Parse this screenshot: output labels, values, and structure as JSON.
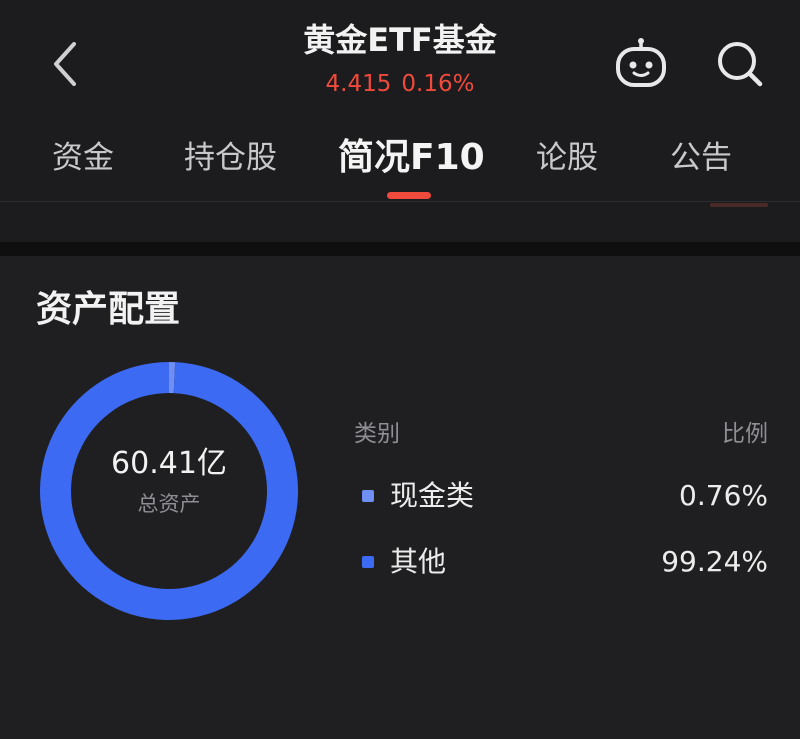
{
  "header": {
    "title": "黄金ETF基金",
    "price": "4.415",
    "change_pct": "0.16%",
    "icons": {
      "back": "chevron-left-icon",
      "assistant": "robot-icon",
      "search": "search-icon"
    }
  },
  "tabs": [
    {
      "label": "资金",
      "active": false
    },
    {
      "label": "持仓股",
      "active": false
    },
    {
      "label": "简况F10",
      "active": true
    },
    {
      "label": "论股",
      "active": false
    },
    {
      "label": "公告",
      "active": false
    }
  ],
  "asset_allocation": {
    "title": "资产配置",
    "total_value": "60.41亿",
    "total_label": "总资产",
    "legend_header": {
      "category": "类别",
      "ratio": "比例"
    },
    "items": [
      {
        "name": "现金类",
        "percent": "0.76%",
        "value": 0.76,
        "color": "#6f8ff5"
      },
      {
        "name": "其他",
        "percent": "99.24%",
        "value": 99.24,
        "color": "#3d6af2"
      }
    ]
  },
  "colors": {
    "background": "#1c1c1e",
    "card": "#1f1f21",
    "accent_red": "#f04a3c",
    "text_primary": "#f2f2f2",
    "text_secondary": "#8e8e93"
  }
}
